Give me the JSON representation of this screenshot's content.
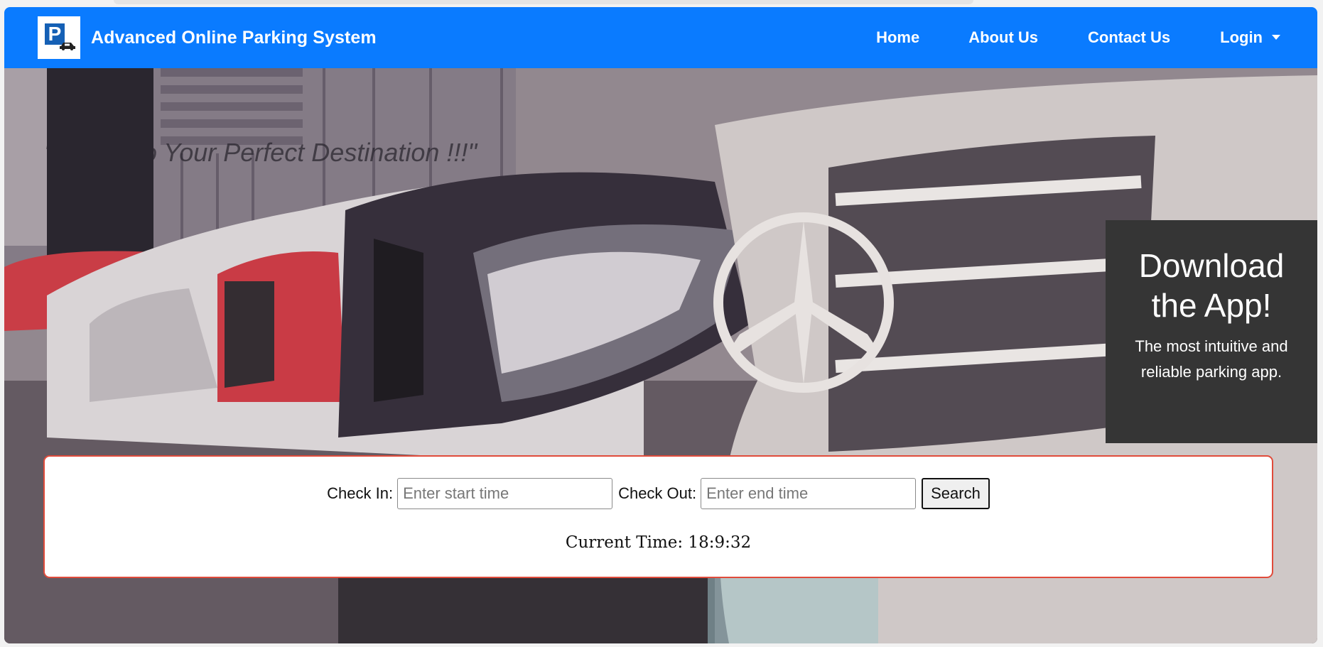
{
  "navbar": {
    "brand_name": "Advanced Online Parking System",
    "brand_logo_icon": "parking-car-logo-icon",
    "links": {
      "home": "Home",
      "about": "About Us",
      "contact": "Contact Us",
      "login": "Login"
    },
    "accent_color": "#0a7bff"
  },
  "hero": {
    "tagline": "\"Switch to Your Perfect Destination !!!\""
  },
  "app_promo": {
    "title": "Download the App!",
    "description": "The most intuitive and reliable parking app."
  },
  "search": {
    "check_in_label": "Check In:",
    "check_in_placeholder": "Enter start time",
    "check_out_label": "Check Out:",
    "check_out_placeholder": "Enter end time",
    "button_label": "Search",
    "border_color": "#e04b3b"
  },
  "clock": {
    "text": "Current Time: 18:9:32"
  }
}
